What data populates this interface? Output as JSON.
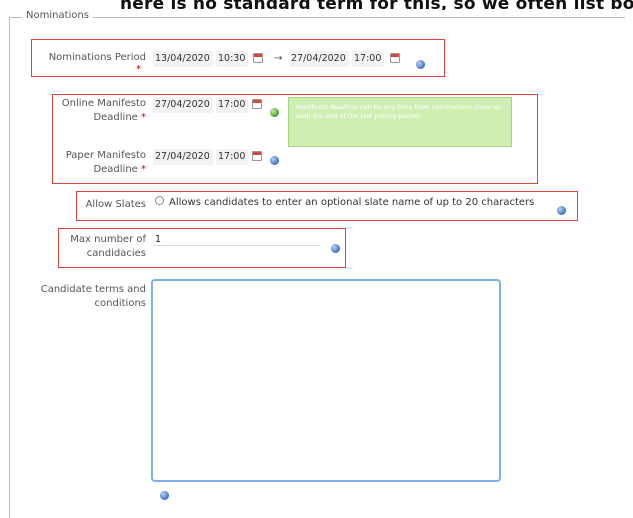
{
  "banner": {
    "text": "here is no standard term for this, so we often list both"
  },
  "fieldset": {
    "legend": "Nominations"
  },
  "nominations_period": {
    "label": "Nominations Period",
    "required_mark": "*",
    "start_date": "13/04/2020",
    "start_time": "10:30",
    "arrow": "→",
    "end_date": "27/04/2020",
    "end_time": "17:00"
  },
  "online_manifesto": {
    "label_line1": "Online Manifesto",
    "label_line2": "Deadline",
    "required_mark": "*",
    "date": "27/04/2020",
    "time": "17:00",
    "tooltip": "Manifesto deadline can be any time from nominations close up until the end of the last polling period."
  },
  "paper_manifesto": {
    "label_line1": "Paper Manifesto",
    "label_line2": "Deadline",
    "required_mark": "*",
    "date": "27/04/2020",
    "time": "17:00"
  },
  "allow_slates": {
    "label": "Allow Slates",
    "option_text": "Allows candidates to enter an optional slate name of up to 20 characters"
  },
  "max_candidacies": {
    "label_line1": "Max number of",
    "label_line2": "candidacies",
    "value": "1"
  },
  "terms": {
    "label_line1": "Candidate terms and",
    "label_line2": "conditions",
    "value": ""
  },
  "colors": {
    "highlight": "#d9453f",
    "info_blue": "#3c6fc1",
    "info_green": "#3f9d2e",
    "textarea_border": "#7fb0ea",
    "tooltip_bg": "#cfeeb2"
  },
  "icons": [
    "calendar-icon",
    "info-icon",
    "radio-button"
  ]
}
